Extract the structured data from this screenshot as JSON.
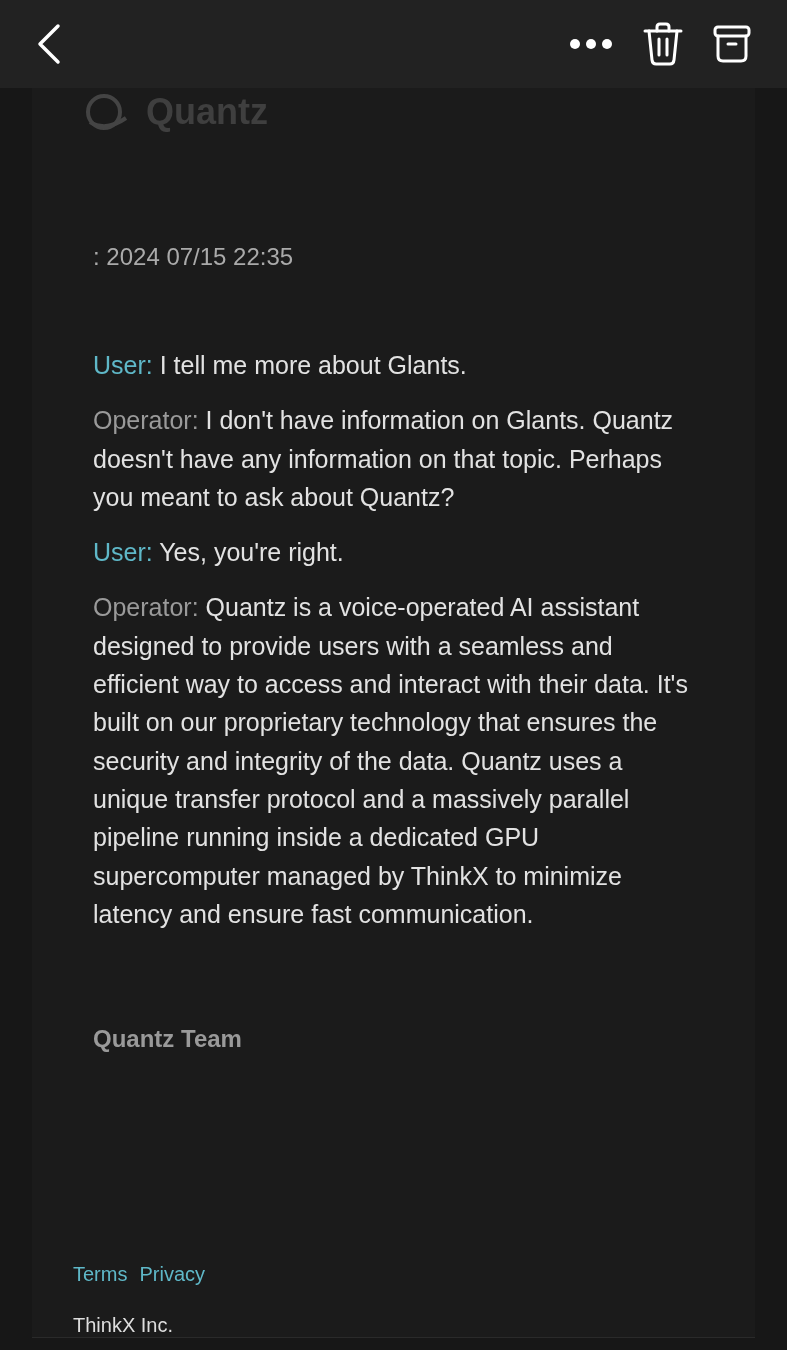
{
  "logo": {
    "text": "Quantz"
  },
  "date": ": 2024 07/15 22:35",
  "messages": [
    {
      "kind": "user",
      "speaker": "User:",
      "text": "I tell me more about Glants."
    },
    {
      "kind": "operator",
      "speaker": "Operator:",
      "text": "I don't have information on Glants. Quantz doesn't have any information on that topic. Perhaps you meant to ask about Quantz?"
    },
    {
      "kind": "user",
      "speaker": "User:",
      "text": "Yes, you're right."
    },
    {
      "kind": "operator",
      "speaker": "Operator:",
      "text": "Quantz is a voice-operated AI assistant designed to provide users with a seamless and efficient way to access and interact with their data. It's built on our proprietary technology that ensures the security and integrity of the data. Quantz uses a unique transfer protocol and a massively parallel pipeline running inside a dedicated GPU supercomputer managed by ThinkX to minimize latency and ensure fast communication."
    }
  ],
  "signature": "Quantz Team",
  "footer": {
    "links": [
      "Terms",
      "Privacy"
    ],
    "company": "ThinkX Inc."
  }
}
